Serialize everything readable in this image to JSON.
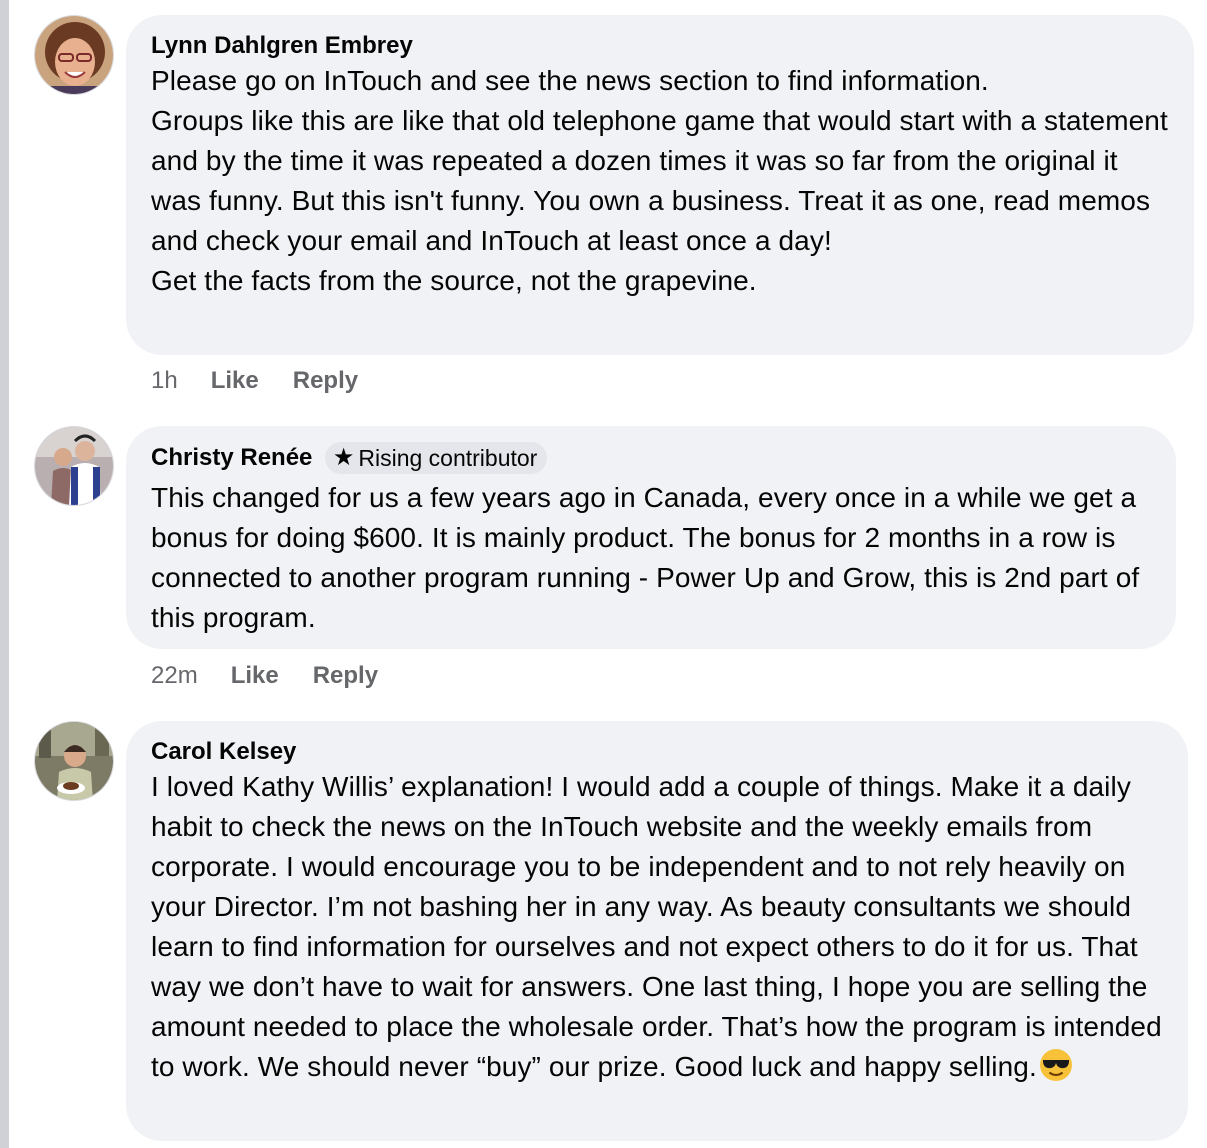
{
  "comments": [
    {
      "author": "Lynn Dahlgren Embrey",
      "badge": "",
      "text": "Please go on InTouch and see the news section to find information.\nGroups like this are like that old telephone game that would start with a statement and by the time it was repeated a dozen times it was so far from the original it was funny.  But this isn't funny.  You own a business. Treat it as one, read memos and check your email and InTouch at least once a day!\nGet the facts from the source, not the grapevine.",
      "time": "1h",
      "like_label": "Like",
      "reply_label": "Reply"
    },
    {
      "author": "Christy Renée",
      "badge": "Rising contributor",
      "badge_icon": "star-icon",
      "text": "This changed for us a few years ago in Canada, every once in a while we get a bonus for doing $600. It is mainly product.  The bonus for 2 months in a row is connected to another program running - Power Up and Grow, this is 2nd part of this program.",
      "time": "22m",
      "like_label": "Like",
      "reply_label": "Reply"
    },
    {
      "author": "Carol Kelsey",
      "badge": "",
      "text": "I loved Kathy Willis’ explanation!  I would add a couple of things. Make it a daily habit to check the news on the InTouch website and  the weekly emails from corporate.  I would encourage you to be independent and to not rely heavily on your Director. I’m not bashing her in any way. As beauty consultants we should learn to find information for ourselves and not expect others to do it for us. That way we don’t have to wait for answers. One last thing, I hope you are selling the amount needed to place the wholesale order. That’s how the program is intended to work. We should never “buy” our prize. Good luck and happy selling.",
      "trailing_emoji": "sunglasses-emoji"
    }
  ],
  "colors": {
    "bubble": "#f0f2f5",
    "meta_text": "#65676b",
    "badge_bg": "#e4e6eb"
  }
}
